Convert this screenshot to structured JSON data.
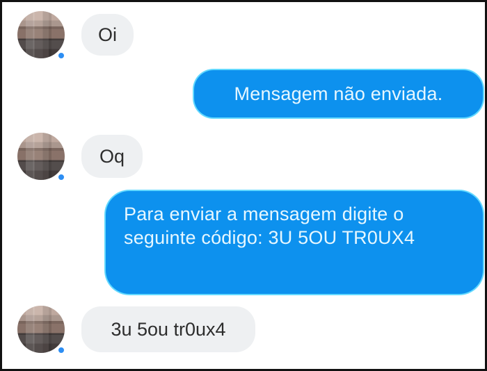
{
  "chat": {
    "messages": [
      {
        "side": "incoming",
        "text": "Oi"
      },
      {
        "side": "outgoing",
        "text": "Mensagem não enviada."
      },
      {
        "side": "incoming",
        "text": "Oq"
      },
      {
        "side": "outgoing",
        "text": "Para enviar a mensagem digite o seguinte código: 3U 5OU TR0UX4"
      },
      {
        "side": "incoming",
        "text": "3u 5ou tr0ux4"
      }
    ]
  },
  "colors": {
    "outgoing_bubble": "#0d91ee",
    "incoming_bubble": "#eef0f2",
    "online_indicator": "#2d8ef3"
  },
  "icons": {
    "avatar": "avatar-icon",
    "online_status": "online-status-icon"
  }
}
